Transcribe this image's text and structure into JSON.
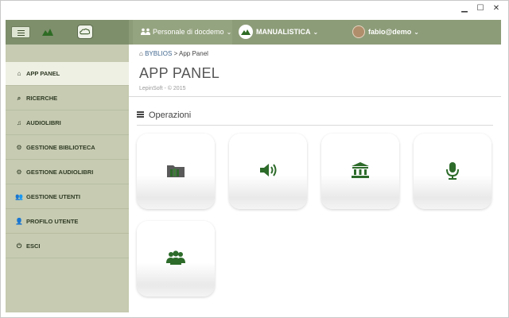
{
  "window": {
    "minimize": "▁",
    "maximize": "☐",
    "close": "✕"
  },
  "topnav": {
    "docdemo_label": "Personale di docdemo",
    "manual_label": "MANUALISTICA",
    "user_label": "fabio@demo",
    "chevron": "⌄"
  },
  "sidebar": {
    "items": [
      {
        "label": "APP PANEL",
        "icon": "home-icon",
        "glyph": "⌂"
      },
      {
        "label": "RICERCHE",
        "icon": "search-icon",
        "glyph": "⌕"
      },
      {
        "label": "AUDIOLIBRI",
        "icon": "music-icon",
        "glyph": "♫"
      },
      {
        "label": "GESTIONE BIBLIOTECA",
        "icon": "gears-icon",
        "glyph": "⚙"
      },
      {
        "label": "GESTIONE AUDIOLIBRI",
        "icon": "gears-icon",
        "glyph": "⚙"
      },
      {
        "label": "GESTIONE UTENTI",
        "icon": "users-icon",
        "glyph": "👥"
      },
      {
        "label": "PROFILO UTENTE",
        "icon": "user-icon",
        "glyph": "👤"
      },
      {
        "label": "ESCI",
        "icon": "power-icon",
        "glyph": "⏻"
      }
    ]
  },
  "breadcrumb": {
    "home_icon": "⌂",
    "root": "BYBLIOS",
    "separator": ">",
    "current": "App Panel"
  },
  "page": {
    "title": "APP PANEL",
    "subtitle": "LepinSoft - © 2015"
  },
  "section": {
    "title": "Operazioni"
  },
  "tiles": [
    {
      "icon": "books-icon"
    },
    {
      "icon": "speaker-icon"
    },
    {
      "icon": "library-icon"
    },
    {
      "icon": "microphone-icon"
    },
    {
      "icon": "users-icon"
    }
  ],
  "colors": {
    "topnav": "#8c9c78",
    "sidebar": "#c6cbb1",
    "accent_green": "#2d6b2a",
    "link": "#41678f"
  }
}
